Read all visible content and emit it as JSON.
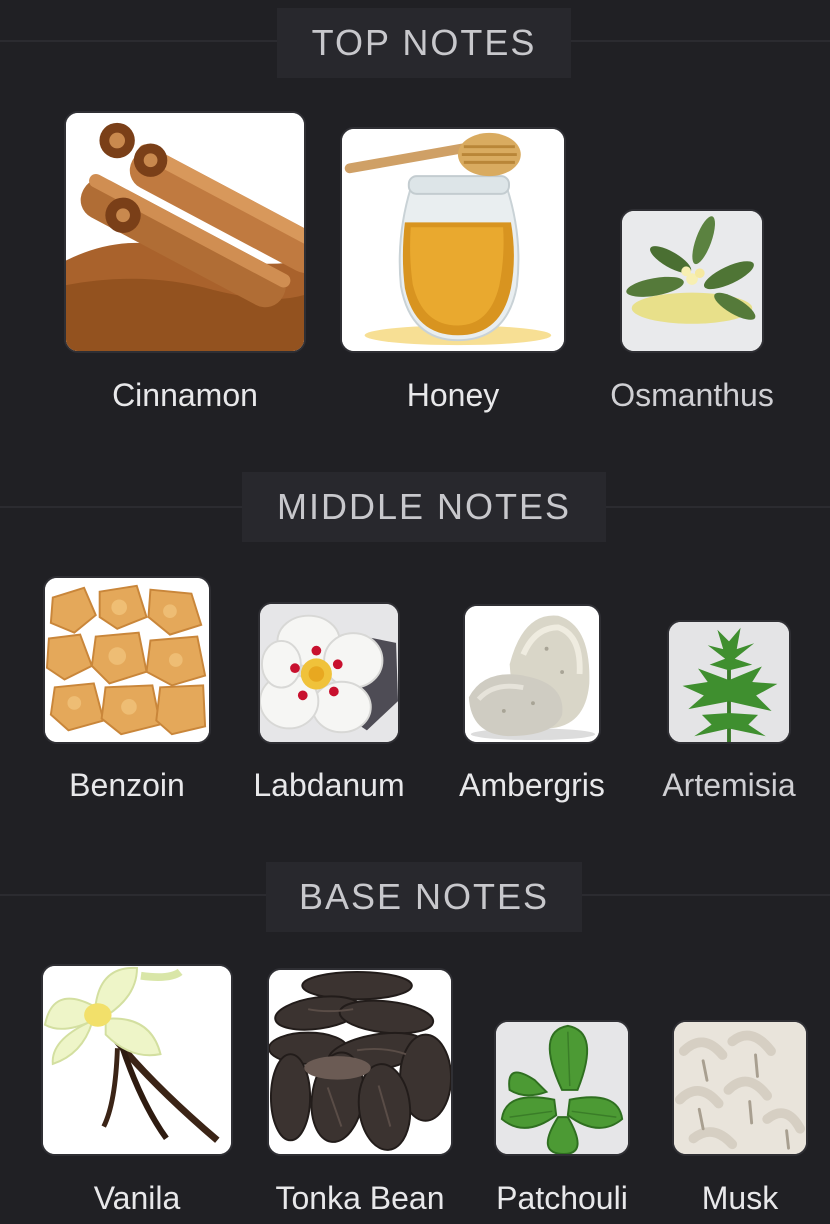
{
  "sections": [
    {
      "title": "TOP NOTES",
      "notes": [
        {
          "label": "Cinnamon",
          "icon": "cinnamon-sticks-photo"
        },
        {
          "label": "Honey",
          "icon": "honey-jar-photo"
        },
        {
          "label": "Osmanthus",
          "icon": "osmanthus-flower-photo"
        }
      ]
    },
    {
      "title": "MIDDLE NOTES",
      "notes": [
        {
          "label": "Benzoin",
          "icon": "benzoin-resin-photo"
        },
        {
          "label": "Labdanum",
          "icon": "labdanum-flower-photo"
        },
        {
          "label": "Ambergris",
          "icon": "ambergris-stone-photo"
        },
        {
          "label": "Artemisia",
          "icon": "artemisia-leaf-photo"
        }
      ]
    },
    {
      "title": "BASE NOTES",
      "notes": [
        {
          "label": "Vanila",
          "icon": "vanilla-orchid-photo"
        },
        {
          "label": "Tonka Bean",
          "icon": "tonka-beans-photo"
        },
        {
          "label": "Patchouli",
          "icon": "patchouli-leaves-photo"
        },
        {
          "label": "Musk",
          "icon": "musk-fur-photo"
        }
      ]
    }
  ],
  "colors": {
    "background": "#202024",
    "header_bg": "#28282d",
    "header_text": "#c8c8cc",
    "label_text": "#e8e8ea"
  }
}
